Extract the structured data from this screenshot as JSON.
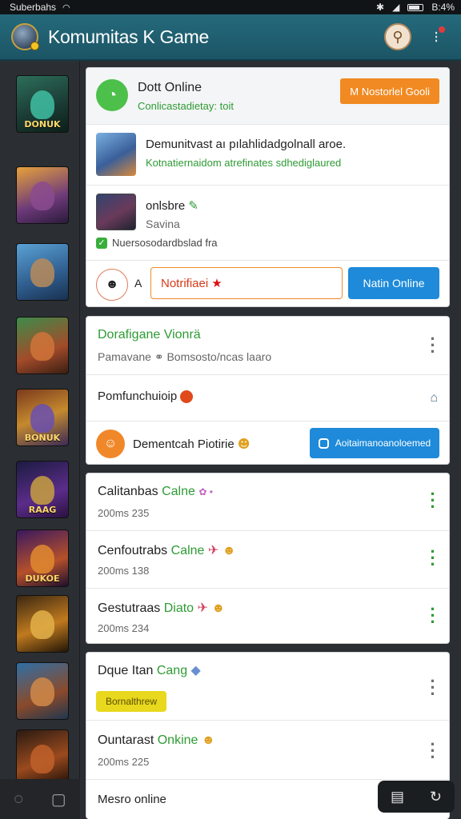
{
  "status": {
    "carrier": "Suberbahs",
    "battery": "B:4%",
    "icons": [
      "wifi-icon",
      "bluetooth-icon",
      "signal-icon",
      "battery-icon"
    ]
  },
  "header": {
    "title": "Komumitas K Game",
    "icons": [
      "app-logo-icon",
      "search-icon",
      "menu-icon"
    ]
  },
  "rail": {
    "thumbs": [
      "DONUK",
      "",
      "",
      "",
      "BONUK",
      "RAAG",
      "DUKOE",
      "",
      "",
      ""
    ],
    "footer_icons": [
      "chat-icon",
      "bookmark-icon"
    ]
  },
  "card1": {
    "head_title": "Dott Online",
    "head_sub": "Conlicastadietay: toit",
    "head_badge": "M Nostorlel Gooli",
    "item1_title": "Demunitvast aı pılahlidadgolnall aroe.",
    "item1_sub": "Kotnatiernaidom atrefinates sdhediglaured",
    "item2_title": "onlsbre",
    "item2_sub": "Savina",
    "check_text": "Nuersosodardbslad fra",
    "compose_letter": "A",
    "compose_value": "Notrifiaei",
    "compose_button": "Natin Online"
  },
  "card2": {
    "row1_title": "Dorafigane Vionrä",
    "row1_sub": "Pamavane",
    "row1_sub2": "Bomsosto/ncas laaro",
    "row2_title": "Pomfunchuioip",
    "row3_title": "Dementcah Piotirie",
    "row3_button": "Aoitaimanoanoloemed"
  },
  "card3": {
    "items": [
      {
        "name": "Calitanbas",
        "game": "Calne",
        "meta": "200ms 235"
      },
      {
        "name": "Cenfoutrabs",
        "game": "Calne",
        "meta": "200ms 138"
      },
      {
        "name": "Gestutraas",
        "game": "Diato",
        "meta": "200ms 234"
      }
    ]
  },
  "card4": {
    "row1_title": "Dque Itan",
    "row1_game": "Cang",
    "row1_pill": "Bornalthrew",
    "row2_title": "Ountarast",
    "row2_game": "Onkine",
    "row2_meta": "200ms 225",
    "row3_title": "Mesro online"
  }
}
